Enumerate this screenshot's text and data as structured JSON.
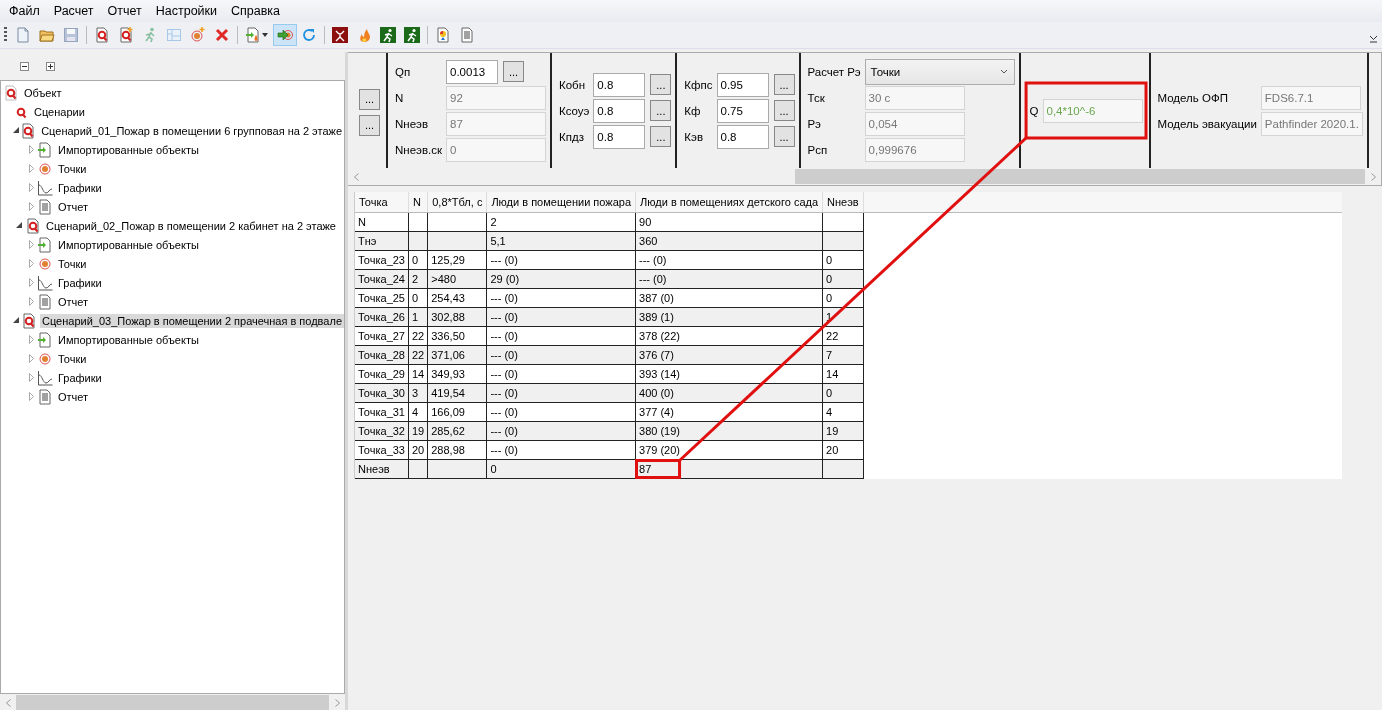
{
  "menu": [
    "Файл",
    "Расчет",
    "Отчет",
    "Настройки",
    "Справка"
  ],
  "toolbar": [
    {
      "kind": "new",
      "pressed": false,
      "disabled": false
    },
    {
      "kind": "open",
      "pressed": false,
      "disabled": false
    },
    {
      "kind": "save",
      "pressed": false,
      "disabled": true
    },
    {
      "kind": "separator"
    },
    {
      "kind": "q",
      "pressed": false,
      "disabled": false
    },
    {
      "kind": "q-add",
      "pressed": false,
      "disabled": false
    },
    {
      "kind": "run",
      "pressed": false,
      "disabled": true
    },
    {
      "kind": "plan",
      "pressed": false,
      "disabled": true
    },
    {
      "kind": "target-add",
      "pressed": false,
      "disabled": false
    },
    {
      "kind": "delete",
      "pressed": false,
      "disabled": false
    },
    {
      "kind": "separator"
    },
    {
      "kind": "import",
      "pressed": false,
      "disabled": false
    },
    {
      "kind": "link",
      "pressed": true,
      "disabled": false
    },
    {
      "kind": "refresh",
      "pressed": false,
      "disabled": false
    },
    {
      "kind": "separator"
    },
    {
      "kind": "fire-box",
      "pressed": false,
      "disabled": false
    },
    {
      "kind": "flame",
      "pressed": false,
      "disabled": false
    },
    {
      "kind": "exit",
      "pressed": false,
      "disabled": false
    },
    {
      "kind": "exit",
      "pressed": false,
      "disabled": false
    },
    {
      "kind": "separator"
    },
    {
      "kind": "bulb",
      "pressed": false,
      "disabled": false
    },
    {
      "kind": "report",
      "pressed": false,
      "disabled": false
    }
  ],
  "tree": [
    {
      "label": "Объект",
      "kind": "object",
      "selected": false,
      "children": [
        {
          "label": "Сценарии",
          "kind": "scenarios",
          "selected": false
        },
        {
          "label": "Сценарий_01_Пожар в помещении 6 групповая на 2 этаже",
          "kind": "scenario",
          "selected": false,
          "expanded": true,
          "children": [
            {
              "label": "Импортированные объекты",
              "kind": "imported",
              "selected": false,
              "expanded": false
            },
            {
              "label": "Точки",
              "kind": "points",
              "selected": false,
              "expanded": false
            },
            {
              "label": "Графики",
              "kind": "charts",
              "selected": false,
              "expanded": false
            },
            {
              "label": "Отчет",
              "kind": "report",
              "selected": false,
              "expanded": false
            }
          ]
        },
        {
          "label": "Сценарий_02_Пожар в помещении 2 кабинет на 2 этаже",
          "kind": "scenario",
          "selected": false,
          "expanded": true,
          "children": [
            {
              "label": "Импортированные объекты",
              "kind": "imported",
              "selected": false,
              "expanded": false
            },
            {
              "label": "Точки",
              "kind": "points",
              "selected": false,
              "expanded": false
            },
            {
              "label": "Графики",
              "kind": "charts",
              "selected": false,
              "expanded": false
            },
            {
              "label": "Отчет",
              "kind": "report",
              "selected": false,
              "expanded": false
            }
          ]
        },
        {
          "label": "Сценарий_03_Пожар в помещении 2 прачечная в подвале",
          "kind": "scenario",
          "selected": true,
          "expanded": true,
          "children": [
            {
              "label": "Импортированные объекты",
              "kind": "imported",
              "selected": false,
              "expanded": false
            },
            {
              "label": "Точки",
              "kind": "points",
              "selected": false,
              "expanded": false
            },
            {
              "label": "Графики",
              "kind": "charts",
              "selected": false,
              "expanded": false
            },
            {
              "label": "Отчет",
              "kind": "report",
              "selected": false,
              "expanded": false
            }
          ]
        }
      ]
    }
  ],
  "params": [
    {
      "kind": "clipped",
      "rows": [
        {
          "button": "..."
        },
        {
          "button": "..."
        }
      ]
    },
    {
      "kind": "normal",
      "rows": [
        {
          "label": "Qп",
          "value": "0.0013",
          "editable": true,
          "button": "..."
        },
        {
          "label": "N",
          "value": "92",
          "editable": false
        },
        {
          "label": "Nнеэв",
          "value": "87",
          "editable": false
        },
        {
          "label": "Nнеэв.ск",
          "value": "0",
          "editable": false
        }
      ]
    },
    {
      "kind": "normal",
      "rows": [
        {
          "label": "Кобн",
          "value": "0.8",
          "editable": true,
          "button": "..."
        },
        {
          "label": "Ксоуэ",
          "value": "0.8",
          "editable": true,
          "button": "..."
        },
        {
          "label": "Кпдз",
          "value": "0.8",
          "editable": true,
          "button": "..."
        }
      ]
    },
    {
      "kind": "normal",
      "rows": [
        {
          "label": "Кфпс",
          "value": "0.95",
          "editable": true,
          "button": "..."
        },
        {
          "label": "Кф",
          "value": "0.75",
          "editable": true,
          "button": "..."
        },
        {
          "label": "Кэв",
          "value": "0.8",
          "editable": true,
          "button": "..."
        }
      ]
    },
    {
      "kind": "normal",
      "rows": [
        {
          "label": "Расчет Рэ",
          "value": "Точки",
          "kind": "combo"
        },
        {
          "label": "Тск",
          "value": "30 с",
          "editable": false
        },
        {
          "label": "Рэ",
          "value": "0,054",
          "editable": false
        },
        {
          "label": "Рсп",
          "value": "0,999676",
          "editable": false
        }
      ]
    },
    {
      "kind": "normal",
      "highlighted": true,
      "rows": [
        {
          "label": "Q",
          "value": "0,4*10^-6",
          "editable": false,
          "color": "#6aa84f"
        }
      ]
    },
    {
      "kind": "normal",
      "rows": [
        {
          "label": "Модель ОФП",
          "value": "FDS6.7.1",
          "editable": false
        },
        {
          "label": "Модель эвакуации",
          "value": "Pathfinder 2020.1.",
          "editable": false
        }
      ]
    }
  ],
  "table": {
    "columns": [
      "Точка",
      "N",
      "0,8*Тбл, с",
      "Люди в помещении пожара",
      "Люди в помещениях детского сада",
      "Nнеэв"
    ],
    "rows": [
      [
        "N",
        null,
        null,
        "2",
        "90",
        null
      ],
      [
        "Тнэ",
        null,
        null,
        "5,1",
        "360",
        null
      ],
      [
        "Точка_23",
        "0",
        "125,29",
        "--- (0)",
        "--- (0)",
        "0"
      ],
      [
        "Точка_24",
        "2",
        ">480",
        "29 (0)",
        "--- (0)",
        "0"
      ],
      [
        "Точка_25",
        "0",
        "254,43",
        "--- (0)",
        "387 (0)",
        "0"
      ],
      [
        "Точка_26",
        "1",
        "302,88",
        "--- (0)",
        "389 (1)",
        "1"
      ],
      [
        "Точка_27",
        "22",
        "336,50",
        "--- (0)",
        "378 (22)",
        "22"
      ],
      [
        "Точка_28",
        "22",
        "371,06",
        "--- (0)",
        "376 (7)",
        "7"
      ],
      [
        "Точка_29",
        "14",
        "349,93",
        "--- (0)",
        "393 (14)",
        "14"
      ],
      [
        "Точка_30",
        "3",
        "419,54",
        "--- (0)",
        "400 (0)",
        "0"
      ],
      [
        "Точка_31",
        "4",
        "166,09",
        "--- (0)",
        "377 (4)",
        "4"
      ],
      [
        "Точка_32",
        "19",
        "285,62",
        "--- (0)",
        "380 (19)",
        "19"
      ],
      [
        "Точка_33",
        "20",
        "288,98",
        "--- (0)",
        "379 (20)",
        "20"
      ],
      [
        "Nнеэв",
        null,
        null,
        "0",
        {
          "text": "87",
          "highlighted": true
        },
        null
      ]
    ]
  }
}
